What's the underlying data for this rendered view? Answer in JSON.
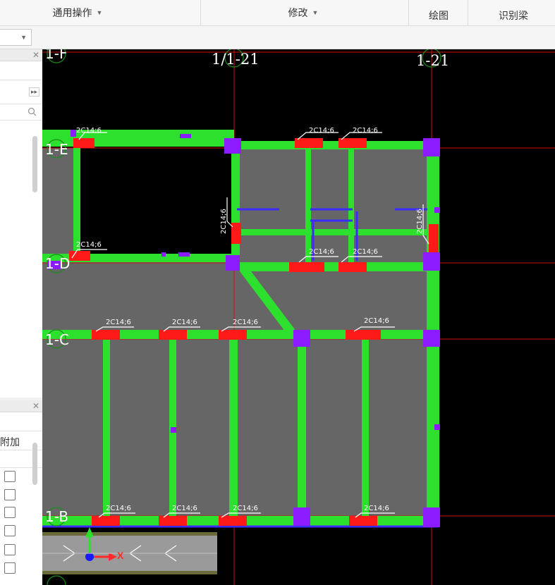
{
  "ribbon": {
    "general_ops": "通用操作",
    "modify": "修改",
    "draw": "绘图",
    "identify_beam": "识别梁"
  },
  "panel_bottom": {
    "column_header": "附加"
  },
  "canvas": {
    "axis_labels": [
      "1/1-21",
      "1-21"
    ],
    "row_labels": [
      "1-F",
      "1-E",
      "1-D",
      "1-C",
      "1-B"
    ],
    "rebar_label": "2C14;6",
    "ucs_x_label": "X"
  },
  "icons": [
    "search-icon",
    "close-icon",
    "chevron-down-icon",
    "expand-arrows-icon"
  ],
  "colors": {
    "canvas_bg": "#000000",
    "beam": "#2ee02e",
    "slab": "#666666",
    "column": "#8a1cff",
    "axis": "#cc1111",
    "rebar": "#ff1a1a"
  }
}
